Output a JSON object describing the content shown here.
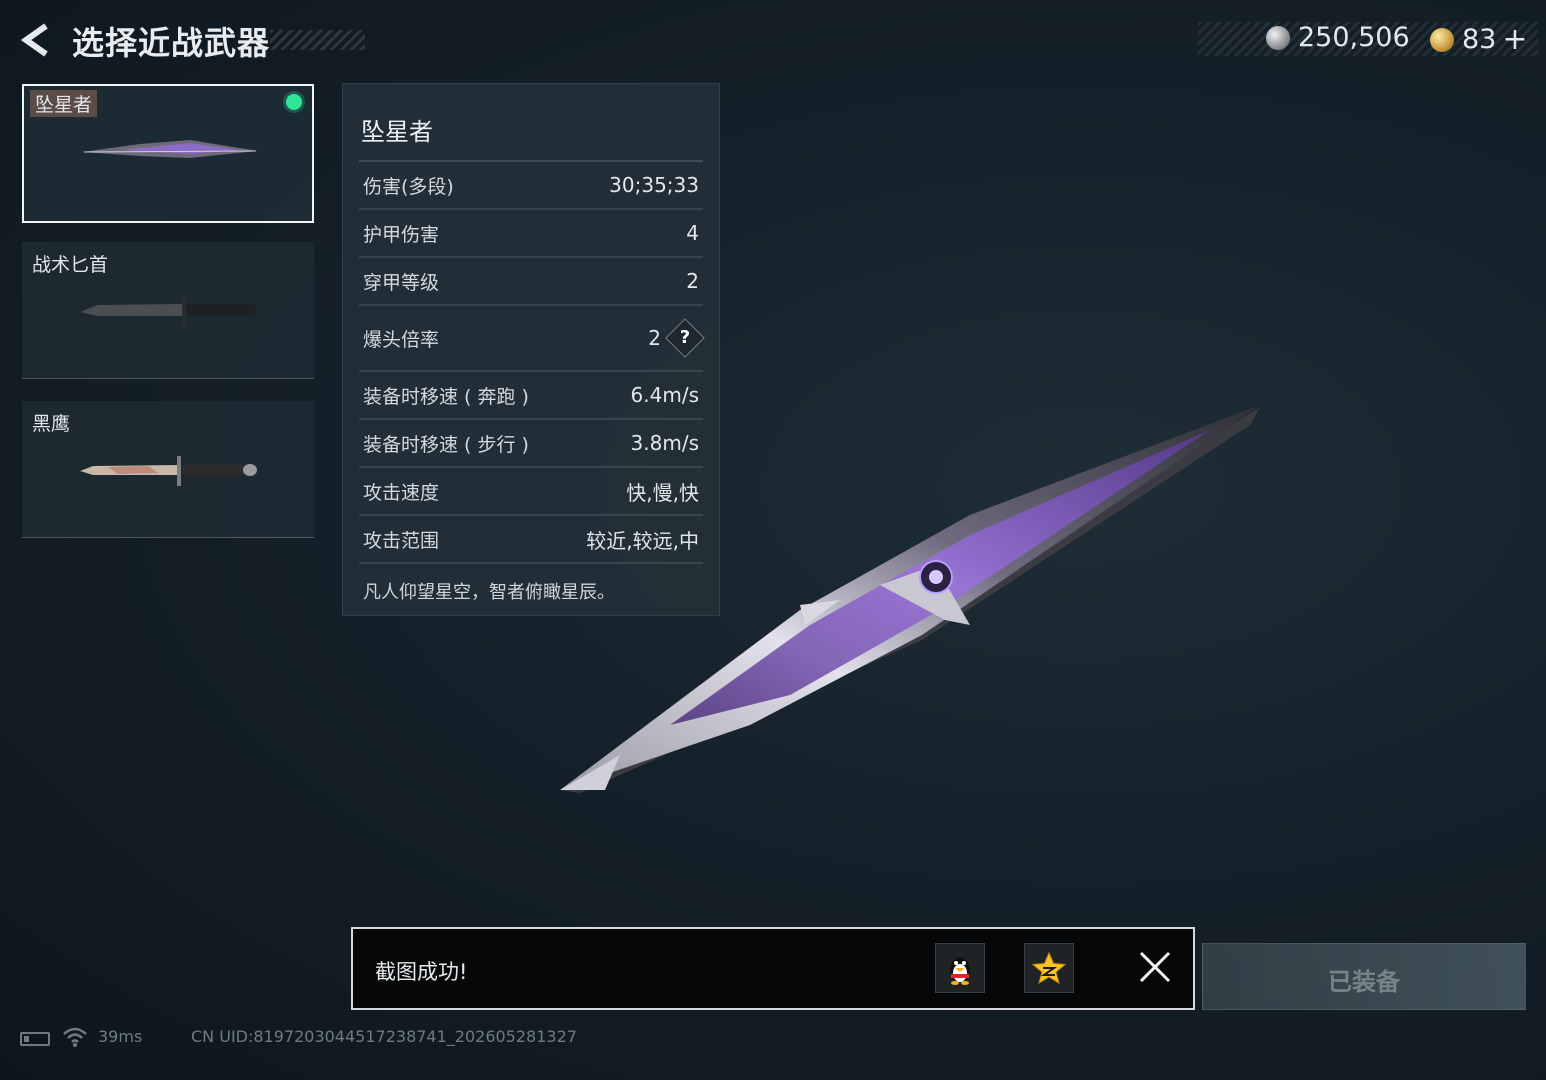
{
  "header": {
    "title": "选择近战武器",
    "back_icon": "chevron-left-icon"
  },
  "currency": {
    "silver": "250,506",
    "gold": "83",
    "plus": "+"
  },
  "weapons": [
    {
      "name": "坠星者",
      "selected": true,
      "equipped": true
    },
    {
      "name": "战术匕首",
      "selected": false,
      "equipped": false
    },
    {
      "name": "黑鹰",
      "selected": false,
      "equipped": false
    }
  ],
  "stats": {
    "name": "坠星者",
    "rows": [
      {
        "label": "伤害(多段)",
        "value": "30;35;33"
      },
      {
        "label": "护甲伤害",
        "value": "4"
      },
      {
        "label": "穿甲等级",
        "value": "2"
      },
      {
        "label": "爆头倍率",
        "value": "2"
      },
      {
        "label": "装备时移速 ( 奔跑 )",
        "value": "6.4m/s"
      },
      {
        "label": "装备时移速 ( 步行 )",
        "value": "3.8m/s"
      },
      {
        "label": "攻击速度",
        "value": "快,慢,快"
      },
      {
        "label": "攻击范围",
        "value": "较近,较远,中"
      }
    ],
    "help_symbol": "?",
    "description": "凡人仰望星空，智者俯瞰星辰。"
  },
  "toast": {
    "message": "截图成功!"
  },
  "equip_button": "已装备",
  "status_bar": {
    "ping": "39ms",
    "uid": "CN UID:8197203044517238741_202605281327"
  },
  "colors": {
    "equipped_dot": "#2ee59a",
    "blade_accent": "#7a4fc2"
  }
}
